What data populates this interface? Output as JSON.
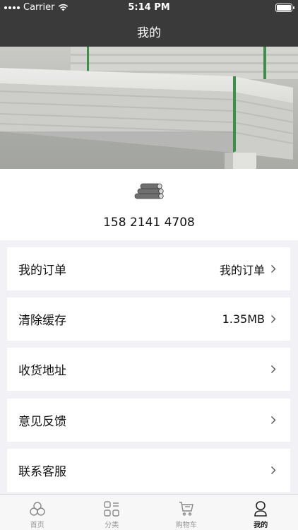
{
  "status_bar": {
    "carrier": "Carrier",
    "time": "5:14 PM"
  },
  "nav": {
    "title": "我的"
  },
  "profile": {
    "phone": "158 2141 4708"
  },
  "menu": [
    {
      "label": "我的订单",
      "value": "我的订单"
    },
    {
      "label": "清除缓存",
      "value": "1.35MB"
    },
    {
      "label": "收货地址",
      "value": ""
    },
    {
      "label": "意见反馈",
      "value": ""
    },
    {
      "label": "联系客服",
      "value": ""
    }
  ],
  "tabs": [
    {
      "label": "首页",
      "icon": "home-icon",
      "active": false
    },
    {
      "label": "分类",
      "icon": "category-icon",
      "active": false
    },
    {
      "label": "购物车",
      "icon": "cart-icon",
      "active": false
    },
    {
      "label": "我的",
      "icon": "profile-icon",
      "active": true
    }
  ],
  "colors": {
    "nav_bg": "#3a3a3a",
    "page_bg": "#f2f1f6",
    "active_tab": "#222222",
    "inactive_tab": "#999999"
  }
}
